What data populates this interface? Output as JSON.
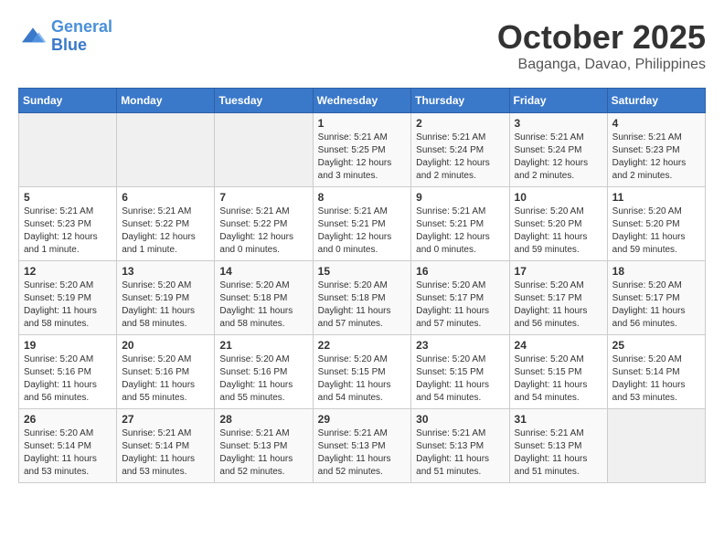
{
  "header": {
    "logo_line1": "General",
    "logo_line2": "Blue",
    "month": "October 2025",
    "location": "Baganga, Davao, Philippines"
  },
  "weekdays": [
    "Sunday",
    "Monday",
    "Tuesday",
    "Wednesday",
    "Thursday",
    "Friday",
    "Saturday"
  ],
  "weeks": [
    [
      {
        "day": "",
        "empty": true
      },
      {
        "day": "",
        "empty": true
      },
      {
        "day": "",
        "empty": true
      },
      {
        "day": "1",
        "sunrise": "5:21 AM",
        "sunset": "5:25 PM",
        "daylight": "12 hours and 3 minutes."
      },
      {
        "day": "2",
        "sunrise": "5:21 AM",
        "sunset": "5:24 PM",
        "daylight": "12 hours and 2 minutes."
      },
      {
        "day": "3",
        "sunrise": "5:21 AM",
        "sunset": "5:24 PM",
        "daylight": "12 hours and 2 minutes."
      },
      {
        "day": "4",
        "sunrise": "5:21 AM",
        "sunset": "5:23 PM",
        "daylight": "12 hours and 2 minutes."
      }
    ],
    [
      {
        "day": "5",
        "sunrise": "5:21 AM",
        "sunset": "5:23 PM",
        "daylight": "12 hours and 1 minute."
      },
      {
        "day": "6",
        "sunrise": "5:21 AM",
        "sunset": "5:22 PM",
        "daylight": "12 hours and 1 minute."
      },
      {
        "day": "7",
        "sunrise": "5:21 AM",
        "sunset": "5:22 PM",
        "daylight": "12 hours and 0 minutes."
      },
      {
        "day": "8",
        "sunrise": "5:21 AM",
        "sunset": "5:21 PM",
        "daylight": "12 hours and 0 minutes."
      },
      {
        "day": "9",
        "sunrise": "5:21 AM",
        "sunset": "5:21 PM",
        "daylight": "12 hours and 0 minutes."
      },
      {
        "day": "10",
        "sunrise": "5:20 AM",
        "sunset": "5:20 PM",
        "daylight": "11 hours and 59 minutes."
      },
      {
        "day": "11",
        "sunrise": "5:20 AM",
        "sunset": "5:20 PM",
        "daylight": "11 hours and 59 minutes."
      }
    ],
    [
      {
        "day": "12",
        "sunrise": "5:20 AM",
        "sunset": "5:19 PM",
        "daylight": "11 hours and 58 minutes."
      },
      {
        "day": "13",
        "sunrise": "5:20 AM",
        "sunset": "5:19 PM",
        "daylight": "11 hours and 58 minutes."
      },
      {
        "day": "14",
        "sunrise": "5:20 AM",
        "sunset": "5:18 PM",
        "daylight": "11 hours and 58 minutes."
      },
      {
        "day": "15",
        "sunrise": "5:20 AM",
        "sunset": "5:18 PM",
        "daylight": "11 hours and 57 minutes."
      },
      {
        "day": "16",
        "sunrise": "5:20 AM",
        "sunset": "5:17 PM",
        "daylight": "11 hours and 57 minutes."
      },
      {
        "day": "17",
        "sunrise": "5:20 AM",
        "sunset": "5:17 PM",
        "daylight": "11 hours and 56 minutes."
      },
      {
        "day": "18",
        "sunrise": "5:20 AM",
        "sunset": "5:17 PM",
        "daylight": "11 hours and 56 minutes."
      }
    ],
    [
      {
        "day": "19",
        "sunrise": "5:20 AM",
        "sunset": "5:16 PM",
        "daylight": "11 hours and 56 minutes."
      },
      {
        "day": "20",
        "sunrise": "5:20 AM",
        "sunset": "5:16 PM",
        "daylight": "11 hours and 55 minutes."
      },
      {
        "day": "21",
        "sunrise": "5:20 AM",
        "sunset": "5:16 PM",
        "daylight": "11 hours and 55 minutes."
      },
      {
        "day": "22",
        "sunrise": "5:20 AM",
        "sunset": "5:15 PM",
        "daylight": "11 hours and 54 minutes."
      },
      {
        "day": "23",
        "sunrise": "5:20 AM",
        "sunset": "5:15 PM",
        "daylight": "11 hours and 54 minutes."
      },
      {
        "day": "24",
        "sunrise": "5:20 AM",
        "sunset": "5:15 PM",
        "daylight": "11 hours and 54 minutes."
      },
      {
        "day": "25",
        "sunrise": "5:20 AM",
        "sunset": "5:14 PM",
        "daylight": "11 hours and 53 minutes."
      }
    ],
    [
      {
        "day": "26",
        "sunrise": "5:20 AM",
        "sunset": "5:14 PM",
        "daylight": "11 hours and 53 minutes."
      },
      {
        "day": "27",
        "sunrise": "5:21 AM",
        "sunset": "5:14 PM",
        "daylight": "11 hours and 53 minutes."
      },
      {
        "day": "28",
        "sunrise": "5:21 AM",
        "sunset": "5:13 PM",
        "daylight": "11 hours and 52 minutes."
      },
      {
        "day": "29",
        "sunrise": "5:21 AM",
        "sunset": "5:13 PM",
        "daylight": "11 hours and 52 minutes."
      },
      {
        "day": "30",
        "sunrise": "5:21 AM",
        "sunset": "5:13 PM",
        "daylight": "11 hours and 51 minutes."
      },
      {
        "day": "31",
        "sunrise": "5:21 AM",
        "sunset": "5:13 PM",
        "daylight": "11 hours and 51 minutes."
      },
      {
        "day": "",
        "empty": true
      }
    ]
  ]
}
